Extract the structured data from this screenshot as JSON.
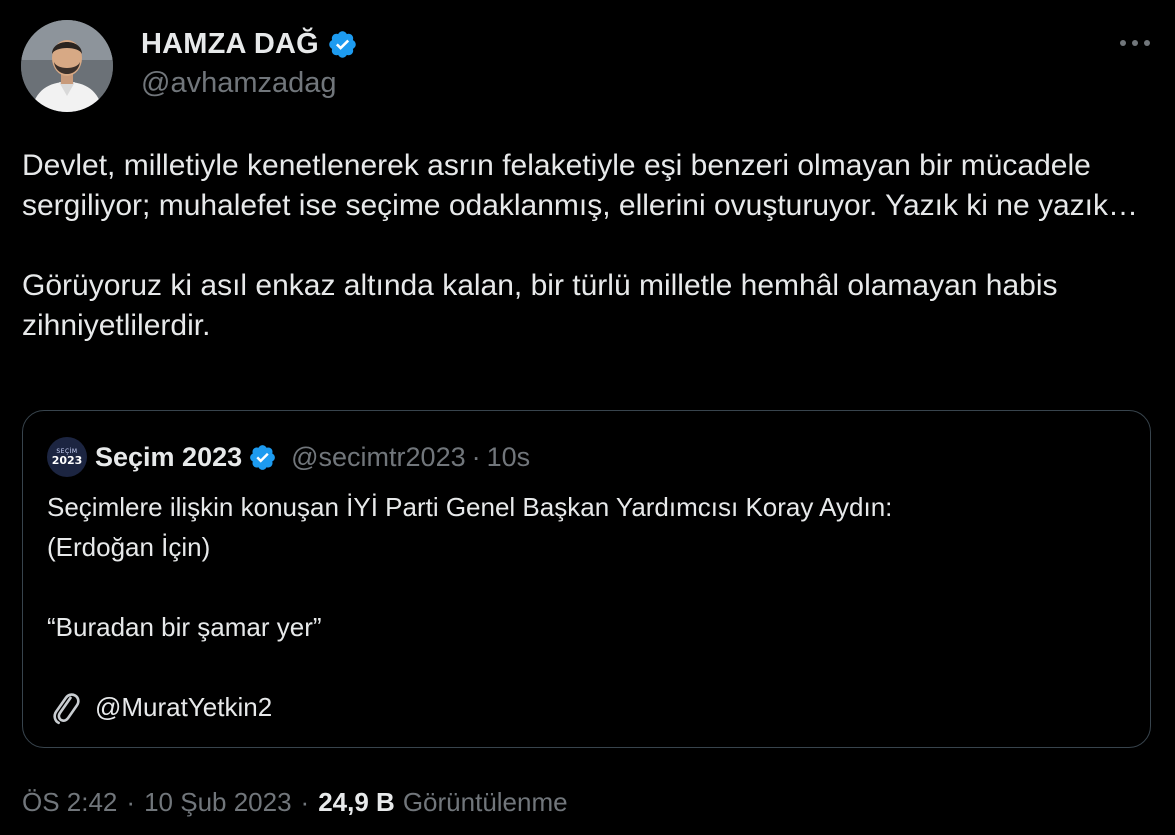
{
  "author": {
    "name": "HAMZA DAĞ",
    "handle": "@avhamzadag",
    "verified": true
  },
  "tweet": {
    "paragraphs": [
      "Devlet, milletiyle kenetlenerek asrın felaketiyle eşi benzeri olmayan bir mücadele sergiliyor; muhalefet ise seçime odaklanmış, ellerini ovuşturuyor. Yazık ki ne yazık…",
      "Görüyoruz ki asıl enkaz altında kalan, bir türlü milletle hemhâl olamayan habis zihniyetlilerdir."
    ]
  },
  "quoted": {
    "avatar_top": "SEÇİM",
    "avatar_bottom": "2023",
    "name": "Seçim 2023",
    "handle": "@secimtr2023",
    "separator": "·",
    "age": "10s",
    "line1": "Seçimlere ilişkin konuşan İYİ Parti Genel Başkan Yardımcısı Koray Aydın:",
    "line2": "(Erdoğan İçin)",
    "quote": "“Buradan bir şamar yer”",
    "attribution": "@MuratYetkin2"
  },
  "meta": {
    "time": "ÖS 2:42",
    "separator": "·",
    "date": "10 Şub 2023",
    "views_count": "24,9 B",
    "views_label": "Görüntülenme"
  },
  "colors": {
    "background": "#000000",
    "text_primary": "#e7e9ea",
    "text_secondary": "#71767b",
    "verified_blue": "#1d9bf0",
    "border": "#38444d"
  },
  "icons": {
    "verified": "verified-badge-icon",
    "more": "more-dots-icon",
    "attachment": "paperclip-icon"
  }
}
